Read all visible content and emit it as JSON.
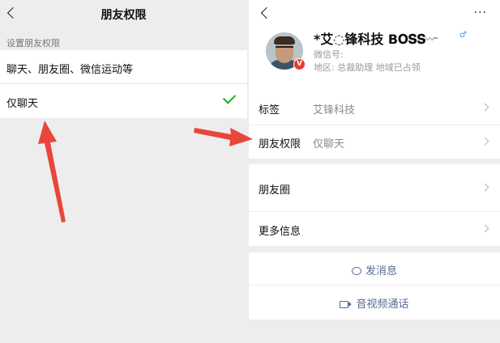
{
  "left_screen": {
    "title": "朋友权限",
    "section_label": "设置朋友权限",
    "options": [
      {
        "label": "聊天、朋友圈、微信运动等",
        "selected": false
      },
      {
        "label": "仅聊天",
        "selected": true
      }
    ],
    "check_icon": "check-icon"
  },
  "right_screen": {
    "more_label": "···",
    "profile": {
      "name": "*艾◌锋科技 B𝐎𝐒𝐒",
      "name_decoration": "〰⁼",
      "wechat_id_label": "微信号:",
      "region_text": "地区: 总裁助理 地域已占领",
      "badge_label": "V"
    },
    "rows": {
      "tag": {
        "label": "标签",
        "value": "艾锋科技"
      },
      "permission": {
        "label": "朋友权限",
        "value": "仅聊天"
      },
      "moments": {
        "label": "朋友圈"
      },
      "more_info": {
        "label": "更多信息"
      }
    },
    "actions": {
      "message": "发消息",
      "call": "音视频通话"
    }
  },
  "colors": {
    "accent_green": "#1aad19",
    "link_blue": "#576b95",
    "annotation_red": "#e8463a",
    "background": "#ededed"
  }
}
